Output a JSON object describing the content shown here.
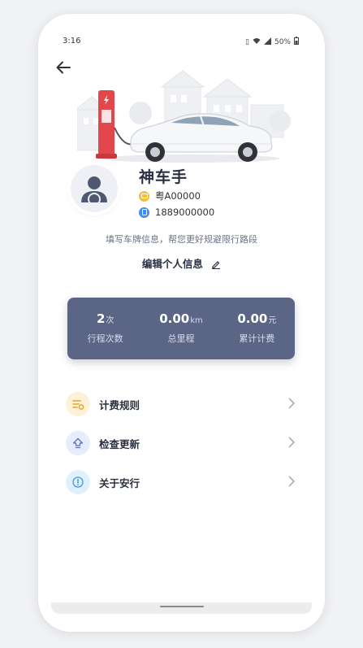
{
  "status_bar": {
    "time": "3:16",
    "battery": "50%"
  },
  "profile": {
    "name": "神车手",
    "plate": "粤A00000",
    "phone": "1889000000",
    "hint": "填写车牌信息，帮您更好规避限行路段",
    "edit_label": "编辑个人信息"
  },
  "stats": [
    {
      "value": "2",
      "unit": "次",
      "label": "行程次数"
    },
    {
      "value": "0.00",
      "unit": "km",
      "label": "总里程"
    },
    {
      "value": "0.00",
      "unit": "元",
      "label": "累计计费"
    }
  ],
  "menu": [
    {
      "label": "计费规则",
      "icon": "billing-rules-icon",
      "bg": "#fdf2d8",
      "fg": "#e3a32a"
    },
    {
      "label": "检查更新",
      "icon": "update-icon",
      "bg": "#e6ecfb",
      "fg": "#5a72c8"
    },
    {
      "label": "关于安行",
      "icon": "info-icon",
      "bg": "#dff0fb",
      "fg": "#3b9de0"
    }
  ],
  "colors": {
    "stats_card": "#5b6686",
    "charger": "#e2484b",
    "text_dark": "#2a3040"
  }
}
